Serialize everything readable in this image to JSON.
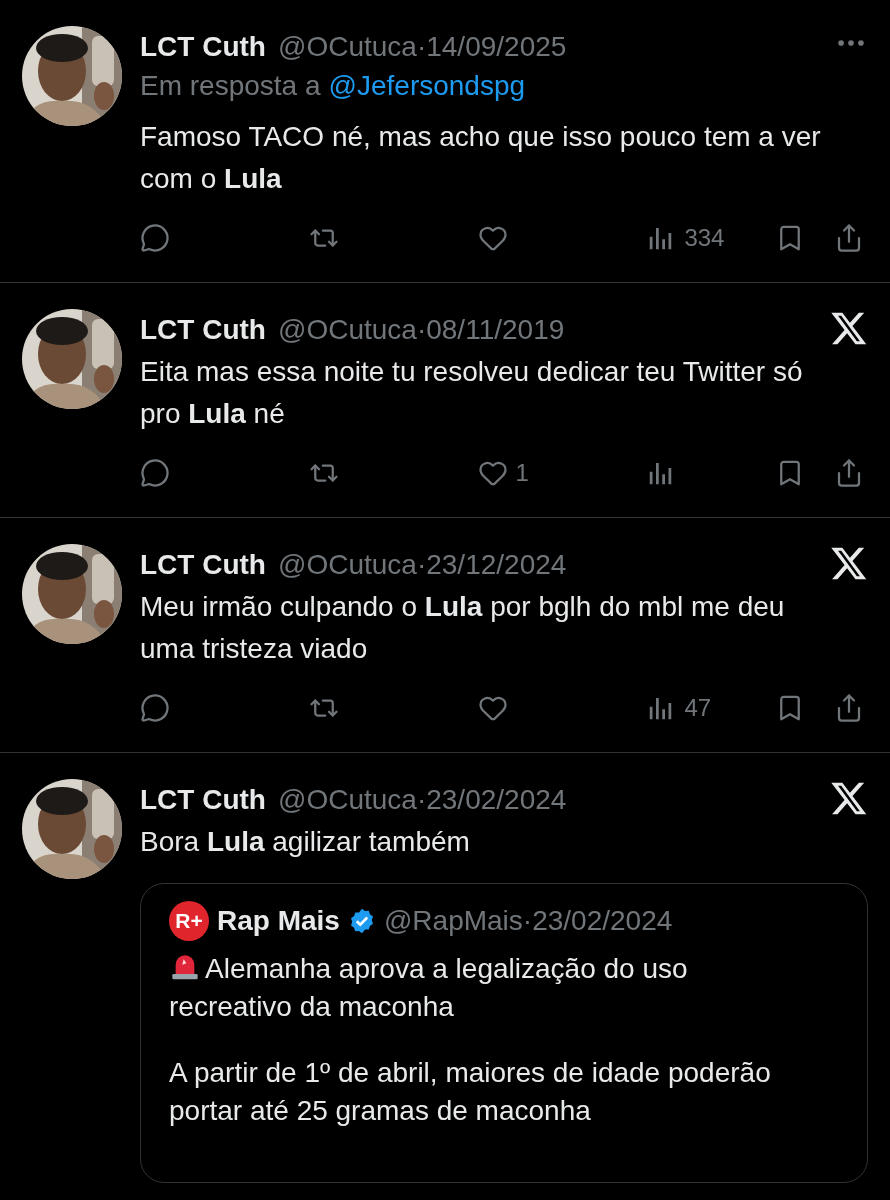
{
  "tweets": [
    {
      "author_name": "LCT Cuth",
      "meta": "@OCutuca·14/09/2025",
      "corner": {
        "kind": "more"
      },
      "reply_prefix": "Em resposta a",
      "reply_handle": "@Jefersondspg",
      "text": "Famoso TACO né, mas acho que isso pouco tem a ver com o **Lula**",
      "actions": [
        {
          "kind": "reply"
        },
        {
          "kind": "repost"
        },
        {
          "kind": "like"
        },
        {
          "kind": "views",
          "count": "334"
        },
        {
          "kind": "bookmark"
        },
        {
          "kind": "share"
        }
      ]
    },
    {
      "author_name": "LCT Cuth",
      "meta": "@OCutuca·08/11/2019",
      "corner": {
        "kind": "x"
      },
      "text": "Eita mas essa noite tu resolveu dedicar teu Twitter só pro **Lula** né",
      "actions": [
        {
          "kind": "reply"
        },
        {
          "kind": "repost"
        },
        {
          "kind": "like",
          "count": "1"
        },
        {
          "kind": "views"
        },
        {
          "kind": "bookmark"
        },
        {
          "kind": "share"
        }
      ]
    },
    {
      "author_name": "LCT Cuth",
      "meta": "@OCutuca·23/12/2024",
      "corner": {
        "kind": "x"
      },
      "text": "Meu irmão culpando o **Lula** por bglh do mbl me deu uma tristeza viado",
      "actions": [
        {
          "kind": "reply"
        },
        {
          "kind": "repost"
        },
        {
          "kind": "like"
        },
        {
          "kind": "views",
          "count": "47"
        },
        {
          "kind": "bookmark"
        },
        {
          "kind": "share"
        }
      ]
    },
    {
      "author_name": "LCT Cuth",
      "meta": "@OCutuca·23/02/2024",
      "corner": {
        "kind": "x"
      },
      "text": "Bora **Lula** agilizar também",
      "quote": {
        "logo_text": "R+",
        "author_name": "Rap Mais",
        "verified": true,
        "meta": "@RapMais·23/02/2024",
        "paragraphs": [
          {
            "kind": "alert",
            "text": "Alemanha aprova a legalização do uso recreativo da maconha"
          },
          {
            "kind": "plain",
            "text": "A partir de 1º de abril, maiores de idade poderão portar até 25 gramas de maconha"
          }
        ]
      }
    }
  ]
}
